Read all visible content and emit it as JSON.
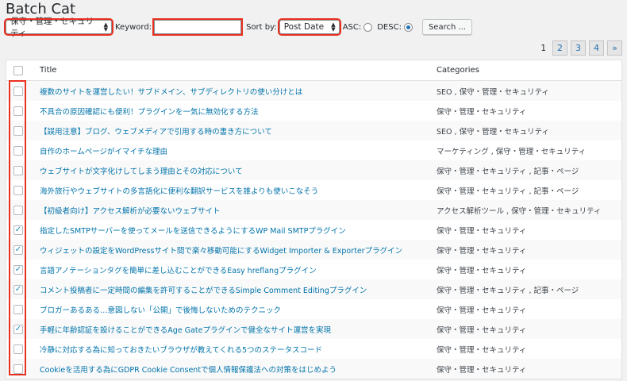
{
  "page": {
    "title": "Batch Cat"
  },
  "filters": {
    "category_value": "保守・管理・セキュリティ",
    "keyword_label": "Keyword:",
    "keyword_value": "",
    "sort_label": "Sort by:",
    "sort_value": "Post Date",
    "asc_label": "ASC:",
    "desc_label": "DESC:",
    "order_selected": "DESC",
    "search_button": "Search ..."
  },
  "pagination": {
    "current": "1",
    "pages": [
      "2",
      "3",
      "4"
    ],
    "next": "»"
  },
  "table": {
    "columns": {
      "title": "Title",
      "categories": "Categories"
    },
    "rows": [
      {
        "title": "複数のサイトを運営したい！サブドメイン、サブディレクトリの使い分けとは",
        "categories": "SEO , 保守・管理・セキュリティ",
        "checked": false
      },
      {
        "title": "不具合の原因確認にも便利！プラグインを一気に無効化する方法",
        "categories": "保守・管理・セキュリティ",
        "checked": false
      },
      {
        "title": "【誤用注意】ブログ、ウェブメディアで引用する時の書き方について",
        "categories": "SEO , 保守・管理・セキュリティ",
        "checked": false
      },
      {
        "title": "自作のホームページがイマイチな理由",
        "categories": "マーケティング , 保守・管理・セキュリティ",
        "checked": false
      },
      {
        "title": "ウェブサイトが文字化けしてしまう理由とその対応について",
        "categories": "保守・管理・セキュリティ , 記事・ページ",
        "checked": false
      },
      {
        "title": "海外旅行やウェブサイトの多言語化に便利な翻訳サービスを誰よりも使いこなそう",
        "categories": "保守・管理・セキュリティ , 記事・ページ",
        "checked": false
      },
      {
        "title": "【初級者向け】アクセス解析が必要ないウェブサイト",
        "categories": "アクセス解析ツール , 保守・管理・セキュリティ",
        "checked": false
      },
      {
        "title": "指定したSMTPサーバーを使ってメールを送信できるようにするWP Mail SMTPプラグイン",
        "categories": "保守・管理・セキュリティ",
        "checked": true
      },
      {
        "title": "ウィジェットの設定をWordPressサイト間で楽々移動可能にするWidget Importer & Exporterプラグイン",
        "categories": "保守・管理・セキュリティ",
        "checked": true
      },
      {
        "title": "言語アノテーションタグを簡単に差し込むことができるEasy hreflangプラグイン",
        "categories": "保守・管理・セキュリティ",
        "checked": true
      },
      {
        "title": "コメント投稿者に一定時間の編集を許可することができるSimple Comment Editingプラグイン",
        "categories": "保守・管理・セキュリティ , 記事・ページ",
        "checked": true
      },
      {
        "title": "ブロガーあるある…意図しない「公開」で後悔しないためのテクニック",
        "categories": "保守・管理・セキュリティ",
        "checked": false
      },
      {
        "title": "手軽に年齢認証を設けることができるAge Gateプラグインで健全なサイト運営を実現",
        "categories": "保守・管理・セキュリティ",
        "checked": true
      },
      {
        "title": "冷静に対応する為に知っておきたいブラウザが教えてくれる5つのステータスコード",
        "categories": "保守・管理・セキュリティ",
        "checked": false
      },
      {
        "title": "Cookieを活用する為にGDPR Cookie Consentで個人情報保護法への対策をはじめよう",
        "categories": "保守・管理・セキュリティ",
        "checked": false
      }
    ]
  },
  "colors": {
    "highlight": "#e8301f",
    "link": "#0073aa",
    "checkmark": "#1e8cbe"
  }
}
